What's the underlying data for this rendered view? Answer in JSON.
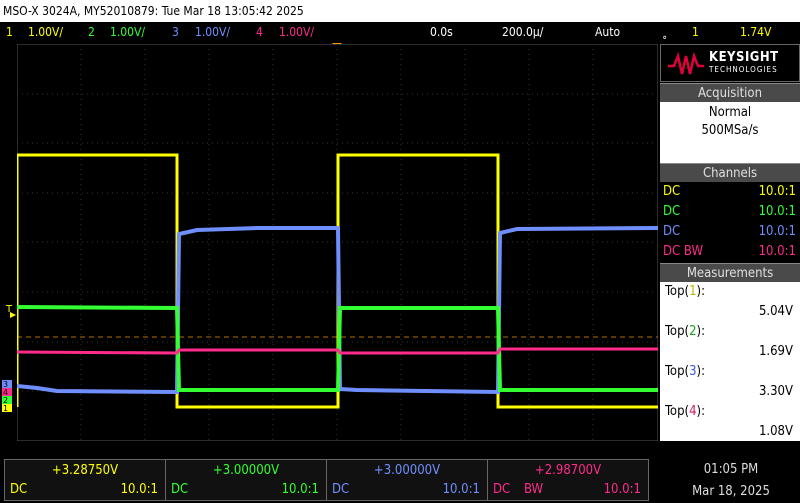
{
  "window": {
    "title": "MSO-X 3024A, MY52010879: Tue Mar 18 13:05:42 2025"
  },
  "statusbar": {
    "ch1": {
      "num": "1",
      "scale": "1.00V/"
    },
    "ch2": {
      "num": "2",
      "scale": "1.00V/"
    },
    "ch3": {
      "num": "3",
      "scale": "1.00V/"
    },
    "ch4": {
      "num": "4",
      "scale": "1.00V/"
    },
    "time_delay": "0.0s",
    "time_scale": "200.0µ/",
    "trigger_mode": "Auto",
    "trigger_source": "1",
    "trigger_level": "1.74V"
  },
  "brand": {
    "name": "KEYSIGHT",
    "sub": "TECHNOLOGIES"
  },
  "acquisition": {
    "header": "Acquisition",
    "mode": "Normal",
    "rate": "500MSa/s"
  },
  "channels": {
    "header": "Channels",
    "rows": [
      {
        "coupling": "DC",
        "probe": "10.0:1",
        "color": "#ffff00"
      },
      {
        "coupling": "DC",
        "probe": "10.0:1",
        "color": "#33ff33"
      },
      {
        "coupling": "DC",
        "probe": "10.0:1",
        "color": "#6f8fff"
      },
      {
        "coupling": "DC BW",
        "probe": "10.0:1",
        "color": "#ff2b8a"
      }
    ]
  },
  "measurements": {
    "header": "Measurements",
    "items": [
      {
        "label": "Top(",
        "ch": "1",
        "close": "):",
        "value": "5.04V"
      },
      {
        "label": "Top(",
        "ch": "2",
        "close": "):",
        "value": "1.69V"
      },
      {
        "label": "Top(",
        "ch": "3",
        "close": "):",
        "value": "3.30V"
      },
      {
        "label": "Top(",
        "ch": "4",
        "close": "):",
        "value": "1.08V"
      }
    ]
  },
  "bottom": {
    "ch1": {
      "offset": "+3.28750V",
      "coupling": "DC",
      "probe": "10.0:1"
    },
    "ch2": {
      "offset": "+3.00000V",
      "coupling": "DC",
      "probe": "10.0:1"
    },
    "ch3": {
      "offset": "+3.00000V",
      "coupling": "DC",
      "probe": "10.0:1"
    },
    "ch4": {
      "offset": "+2.98700V",
      "coupling": "DC",
      "bw": "BW",
      "probe": "10.0:1"
    },
    "time": "01:05 PM",
    "date": "Mar 18, 2025"
  },
  "colors": {
    "ch1": "#ffff00",
    "ch2": "#33ff33",
    "ch3": "#6f8fff",
    "ch4": "#ff2b8a",
    "trigger_marker": "#ff9900"
  },
  "markers": {
    "trigger_label": "T",
    "ground_labels": [
      "1",
      "2",
      "3",
      "4"
    ]
  }
}
